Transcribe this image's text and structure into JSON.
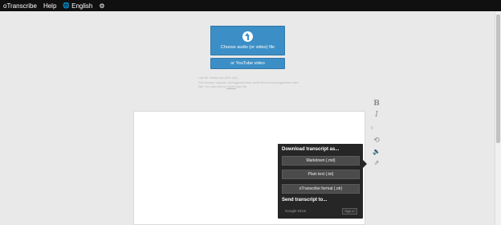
{
  "topbar": {
    "app_name": "oTranscribe",
    "help": "Help",
    "language": "English",
    "globe_icon": "globe-icon",
    "settings_icon": "gear-icon"
  },
  "file_input": {
    "choose_label": "Choose audio (or video) file",
    "youtube_label": "or YouTube video",
    "upload_icon": "upload-arrow-icon"
  },
  "info": {
    "last_file": "Last file: Heads.mp4 (605 mp3)",
    "support_text": "Your browser supports mp3/ogg/webm/wav audio files and mp4/ogg/webm video files. You may need to",
    "support_link": "convert",
    "support_tail": "your file."
  },
  "side_controls": {
    "bold": "B",
    "italic": "I",
    "word_count": "0",
    "history_icon": "history-icon",
    "speaker_icon": "speaker-icon",
    "export_icon": "export-icon"
  },
  "export_menu": {
    "download_heading": "Download transcript as...",
    "options": [
      "Markdown (.md)",
      "Plain text (.txt)",
      "oTranscribe format (.otr)"
    ],
    "send_heading": "Send transcript to...",
    "google_drive": "Google Drive",
    "sign_in": "Sign in"
  }
}
